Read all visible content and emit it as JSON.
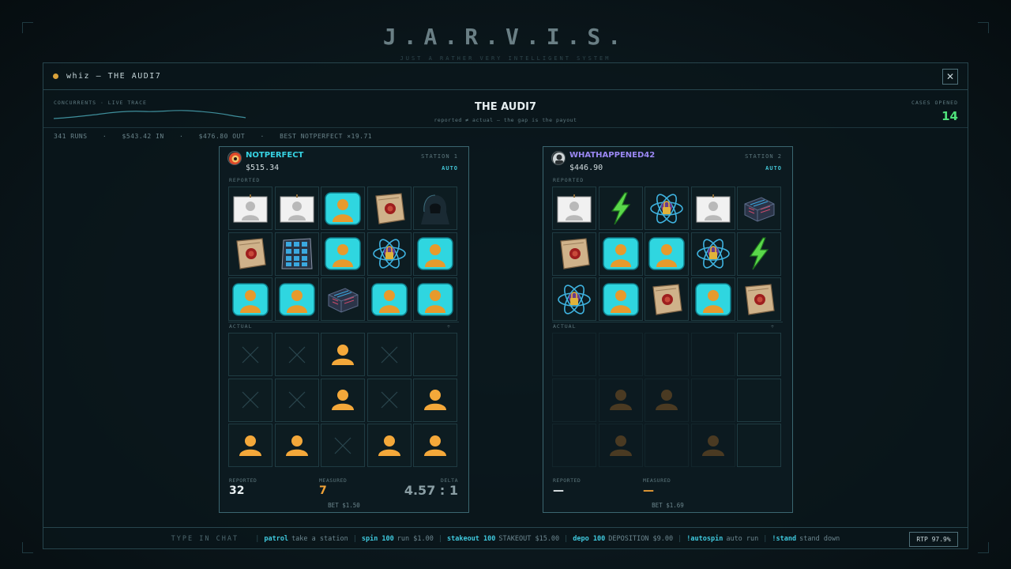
{
  "header": {
    "title": "J.A.R.V.I.S.",
    "subtitle": "JUST A RATHER VERY INTELLIGENT SYSTEM"
  },
  "window": {
    "title": "whiz — THE AUDI7",
    "close_label": "✕"
  },
  "info": {
    "trace_label": "CONCURRENTS · LIVE TRACE",
    "game_title": "THE AUDI7",
    "game_subtitle": "reported ≠ actual — the gap is the payout",
    "cases_label": "CASES OPENED",
    "cases_value": "14"
  },
  "stats": {
    "runs": "341 RUNS",
    "in": "$543.42 IN",
    "out": "$476.80 OUT",
    "best": "BEST NOTPERFECT ×19.71"
  },
  "labels": {
    "reported": "REPORTED",
    "actual": "ACTUAL",
    "reported_foot": "REPORTED",
    "measured_foot": "MEASURED",
    "delta_foot": "DELTA"
  },
  "stations": [
    {
      "name": "NOTPERFECT",
      "balance": "$515.34",
      "label": "STATION 1",
      "mode": "AUTO",
      "reported_grid": [
        "portrait",
        "portrait",
        "bust",
        "scroll",
        "hacker",
        "scroll",
        "server",
        "bust",
        "atom",
        "bust",
        "bust",
        "bust",
        "chip",
        "bust",
        "bust"
      ],
      "actual_grid": [
        "x",
        "x",
        "person",
        "x",
        "empty",
        "x",
        "x",
        "person",
        "x",
        "person",
        "person",
        "person",
        "x",
        "person",
        "person"
      ],
      "reported_value": "32",
      "measured_value": "7",
      "delta_value": "4.57 : 1",
      "bet": "BET $1.50"
    },
    {
      "name": "WHATHAPPENED42",
      "balance": "$446.90",
      "label": "STATION 2",
      "mode": "AUTO",
      "reported_grid": [
        "portrait",
        "bolt",
        "atom",
        "portrait",
        "chip",
        "scroll",
        "bust",
        "bust",
        "atom",
        "bolt",
        "atom",
        "bust",
        "scroll",
        "bust",
        "scroll"
      ],
      "actual_grid": [
        "blank",
        "blank",
        "blank",
        "blank",
        "frame",
        "blank",
        "dimperson",
        "dimperson",
        "blank",
        "frame",
        "blank",
        "dimperson",
        "blank",
        "dimperson",
        "frame"
      ],
      "reported_value": "—",
      "measured_value": "—",
      "bet": "BET $1.69"
    }
  ],
  "commands": {
    "type_label": "TYPE IN CHAT",
    "items": [
      {
        "kw": "patrol",
        "desc": "take a station"
      },
      {
        "kw": "spin 100",
        "desc": "run $1.00"
      },
      {
        "kw": "stakeout 100",
        "desc": "STAKEOUT $15.00"
      },
      {
        "kw": "depo 100",
        "desc": "DEPOSITION $9.00"
      },
      {
        "kw": "!autospin",
        "desc": "auto run"
      },
      {
        "kw": "!stand",
        "desc": "stand down"
      }
    ],
    "rtp": "RTP 97.9%"
  },
  "colors": {
    "accent": "#37d3e3",
    "station2_name": "#9b88f3",
    "orange": "#f0a237",
    "green": "#4fe07a"
  }
}
